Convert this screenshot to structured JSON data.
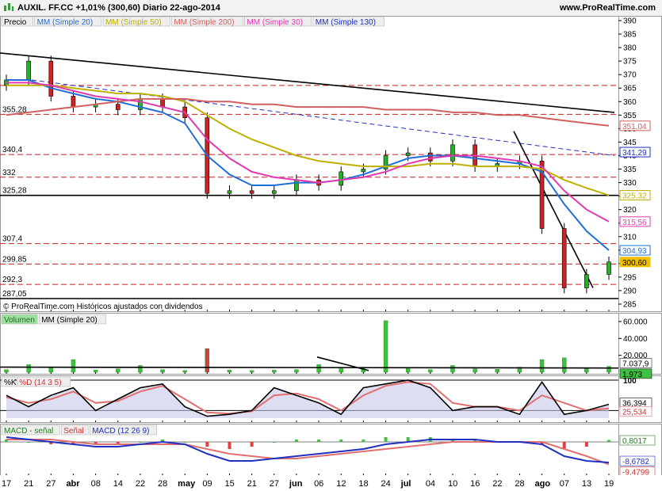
{
  "header": {
    "title": "AUXIL. FF.CC   +1,01% (300,60)   Diario   22-ago-2014",
    "site": "www.ProRealTime.com"
  },
  "price_panel": {
    "legend": [
      "Precio",
      "MM (Simple 20)",
      "MM (Simple 50)",
      "MM (Simple 200)",
      "MM (Simple 30)",
      "MM (Simple 130)"
    ],
    "legend_colors": [
      "#000000",
      "#1f6fd6",
      "#bfb000",
      "#d06060",
      "#e03ab0",
      "#2030c0"
    ],
    "copyright": "© ProRealTime.com  Históricos ajustados con dividendos",
    "left_levels": [
      "355,28",
      "340,4",
      "332",
      "325,28",
      "307,4",
      "299,85",
      "292,3",
      "287,05"
    ],
    "price_tags": [
      {
        "text": "351,04",
        "color": "#d06060"
      },
      {
        "text": "341,29",
        "color": "#2030c0"
      },
      {
        "text": "325,32",
        "color": "#bfb000"
      },
      {
        "text": "315,56",
        "color": "#e03ab0"
      },
      {
        "text": "304,93",
        "color": "#1f6fd6"
      },
      {
        "text": "300,60",
        "color": "#f0c000"
      }
    ]
  },
  "volume_panel": {
    "legend": [
      "Volumen",
      "MM (Simple 20)"
    ],
    "tags": [
      "7.037,9",
      "1.973"
    ]
  },
  "stoch_panel": {
    "legend": [
      "%K",
      "%D (14 3 5)"
    ],
    "tags": [
      "36,394",
      "25,534"
    ]
  },
  "macd_panel": {
    "legend": [
      "MACD - señal",
      "Señal",
      "MACD (12 26 9)"
    ],
    "tags": [
      "0,8017",
      "-8,6782",
      "-9,4799"
    ]
  },
  "chart_data": [
    {
      "type": "line",
      "title": "AUXIL. FF.CC Diario 22-ago-2014",
      "ylim": [
        285,
        390
      ],
      "x": [
        "17",
        "21",
        "27",
        "abr",
        "08",
        "14",
        "22",
        "28",
        "may",
        "09",
        "15",
        "21",
        "27",
        "jun",
        "06",
        "12",
        "18",
        "24",
        "jul",
        "04",
        "10",
        "16",
        "22",
        "28",
        "ago",
        "07",
        "13",
        "19"
      ],
      "y_ticks": [
        285,
        290,
        295,
        300,
        305,
        310,
        315,
        320,
        325,
        330,
        335,
        340,
        345,
        350,
        355,
        360,
        365,
        370,
        375,
        380,
        385,
        390
      ],
      "series": [
        {
          "name": "Precio",
          "values": [
            368,
            375,
            362,
            358,
            359,
            357,
            361,
            358,
            354,
            326,
            327,
            326,
            327,
            331,
            329,
            334,
            335,
            340,
            341,
            338,
            344,
            336,
            337,
            338,
            313,
            291,
            296,
            300.6
          ]
        },
        {
          "name": "MM (Simple 20)",
          "values": [
            368,
            368,
            365,
            363,
            361,
            360,
            358,
            356,
            352,
            340,
            333,
            329,
            329,
            330,
            330,
            331,
            333,
            336,
            339,
            340,
            340,
            339,
            338,
            337,
            334,
            322,
            312,
            304.93
          ]
        },
        {
          "name": "MM (Simple 50)",
          "values": [
            366,
            366,
            366,
            365,
            364,
            363,
            363,
            362,
            360,
            355,
            350,
            346,
            343,
            340,
            338,
            337,
            336,
            336,
            336,
            337,
            337,
            336,
            336,
            336,
            335,
            331,
            328,
            325.32
          ]
        },
        {
          "name": "MM (Simple 200)",
          "values": [
            355,
            356,
            357,
            358,
            359,
            360,
            361,
            361,
            361,
            360,
            360,
            359,
            359,
            358,
            358,
            358,
            358,
            357,
            357,
            357,
            356,
            356,
            355,
            355,
            354,
            353,
            352,
            351.04
          ]
        },
        {
          "name": "MM (Simple 30)",
          "values": [
            367,
            367,
            366,
            364,
            362,
            361,
            360,
            358,
            356,
            346,
            339,
            334,
            332,
            331,
            330,
            331,
            332,
            334,
            337,
            339,
            340,
            340,
            339,
            338,
            336,
            327,
            320,
            315.56
          ]
        }
      ]
    },
    {
      "type": "bar",
      "title": "Volumen",
      "ylim": [
        0,
        60000
      ],
      "y_ticks": [
        "60.000",
        "40.000",
        "20.000"
      ],
      "values": [
        3000,
        9000,
        6000,
        15000,
        2500,
        4000,
        8000,
        3000,
        2000,
        28000,
        2500,
        2000,
        2500,
        3000,
        9000,
        5000,
        6000,
        61000,
        5000,
        3000,
        8000,
        4000,
        3500,
        6000,
        15000,
        17000,
        5000,
        7000
      ]
    },
    {
      "type": "line",
      "title": "%K %D (14 3 5)",
      "ylim": [
        0,
        100
      ],
      "y_ticks": [
        "100"
      ],
      "series": [
        {
          "name": "%K",
          "values": [
            60,
            30,
            60,
            80,
            20,
            50,
            80,
            90,
            30,
            5,
            10,
            20,
            80,
            60,
            40,
            10,
            80,
            90,
            100,
            80,
            20,
            30,
            30,
            10,
            95,
            10,
            20,
            36.394
          ]
        },
        {
          "name": "%D",
          "values": [
            55,
            40,
            50,
            70,
            40,
            45,
            70,
            85,
            50,
            15,
            12,
            18,
            60,
            65,
            50,
            20,
            60,
            85,
            95,
            90,
            40,
            30,
            30,
            20,
            60,
            40,
            20,
            25.534
          ]
        }
      ]
    },
    {
      "type": "line",
      "title": "MACD (12 26 9)",
      "series": [
        {
          "name": "MACD",
          "values": [
            2,
            1,
            0,
            -1,
            -2,
            -2,
            -1,
            0,
            -1,
            -5,
            -8,
            -8,
            -7,
            -6,
            -5,
            -4,
            -3,
            -1,
            0,
            1,
            1,
            1,
            0,
            0,
            -1,
            -6,
            -8,
            -8.6782
          ]
        },
        {
          "name": "Señal",
          "values": [
            1,
            1,
            1,
            0,
            -1,
            -1,
            -1,
            -1,
            -1,
            -3,
            -5,
            -6,
            -7,
            -7,
            -6,
            -5,
            -4,
            -3,
            -2,
            -1,
            0,
            0,
            0,
            0,
            0,
            -3,
            -6,
            -9.4799
          ]
        },
        {
          "name": "MACD - señal",
          "values": [
            1,
            0,
            -1,
            -1,
            -1,
            -1,
            0,
            1,
            0,
            -2,
            -3,
            -2,
            0,
            1,
            1,
            1,
            1,
            2,
            2,
            2,
            1,
            1,
            0,
            0,
            -1,
            -3,
            -2,
            0.8017
          ]
        }
      ]
    }
  ]
}
